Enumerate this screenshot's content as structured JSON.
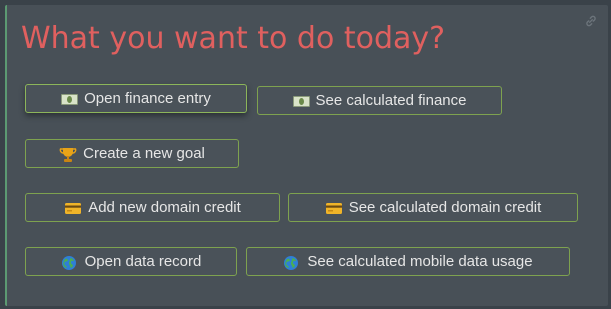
{
  "title": "What you want to do today?",
  "colors": {
    "title": "#e0605f",
    "button_border": "#7ea24f",
    "panel": "#485057",
    "accent_bar": "#5c9a72"
  },
  "icons": {
    "link": "link-icon",
    "finance": "banknote-icon",
    "goal": "trophy-icon",
    "credit": "credit-card-icon",
    "data": "globe-icon"
  },
  "buttons": {
    "open_finance": "Open finance entry",
    "see_finance": "See calculated finance",
    "create_goal": "Create a new goal",
    "add_credit": "Add new domain credit",
    "see_credit": "See calculated domain credit",
    "open_data": "Open data record",
    "see_data": "See calculated mobile data usage"
  }
}
